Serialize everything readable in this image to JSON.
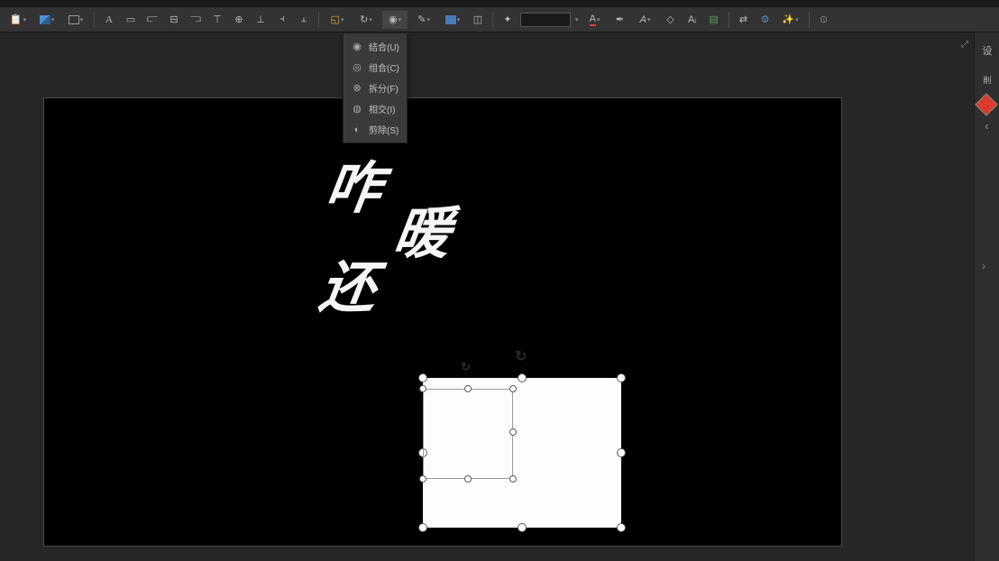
{
  "toolbar": {
    "icons": [
      {
        "name": "paste-icon",
        "glyph": "📋"
      },
      {
        "name": "image-icon",
        "glyph": "🖼"
      },
      {
        "name": "screenshot-icon",
        "glyph": "▣"
      },
      {
        "name": "textbox-icon",
        "glyph": "A"
      },
      {
        "name": "header-icon",
        "glyph": "▭"
      },
      {
        "name": "wordart-icon",
        "glyph": "𝐀"
      },
      {
        "name": "align-left-icon",
        "glyph": "⫍"
      },
      {
        "name": "align-center-icon",
        "glyph": "⫎"
      },
      {
        "name": "align-top-icon",
        "glyph": "⫟"
      },
      {
        "name": "align-middle-icon",
        "glyph": "⫠"
      },
      {
        "name": "distribute-h-icon",
        "glyph": "⫞"
      },
      {
        "name": "distribute-v-icon",
        "glyph": "⫡"
      },
      {
        "name": "group-icon",
        "glyph": "⬒"
      },
      {
        "name": "ungroup-icon",
        "glyph": "⬓"
      },
      {
        "name": "bring-front-icon",
        "glyph": "◱"
      },
      {
        "name": "send-back-icon",
        "glyph": "◲"
      },
      {
        "name": "rotate-icon",
        "glyph": "↻"
      },
      {
        "name": "merge-shapes-icon",
        "glyph": "◉"
      },
      {
        "name": "edit-points-icon",
        "glyph": "✎"
      },
      {
        "name": "shape-fill-icon",
        "glyph": "▰"
      },
      {
        "name": "shape-outline-icon",
        "glyph": "◫"
      },
      {
        "name": "shape-effects-icon",
        "glyph": "✦"
      }
    ],
    "font_color_label": "A",
    "text_effects_label": "A",
    "clear_format_label": "◇",
    "format_painter_label": "Aᵢ",
    "selection_pane_glyph": "▤",
    "replace_glyph": "⇄",
    "find_glyph": "⚙",
    "ai_glyph": "✨"
  },
  "dropdown": {
    "items": [
      {
        "label": "结合(U)",
        "name": "union"
      },
      {
        "label": "组合(C)",
        "name": "combine"
      },
      {
        "label": "拆分(F)",
        "name": "fragment"
      },
      {
        "label": "相交(I)",
        "name": "intersect"
      },
      {
        "label": "剪除(S)",
        "name": "subtract"
      }
    ]
  },
  "canvas": {
    "text1": "咋",
    "text2": "暖",
    "text3": "还"
  },
  "right_panel": {
    "tab1": "设",
    "tab2": "削"
  }
}
